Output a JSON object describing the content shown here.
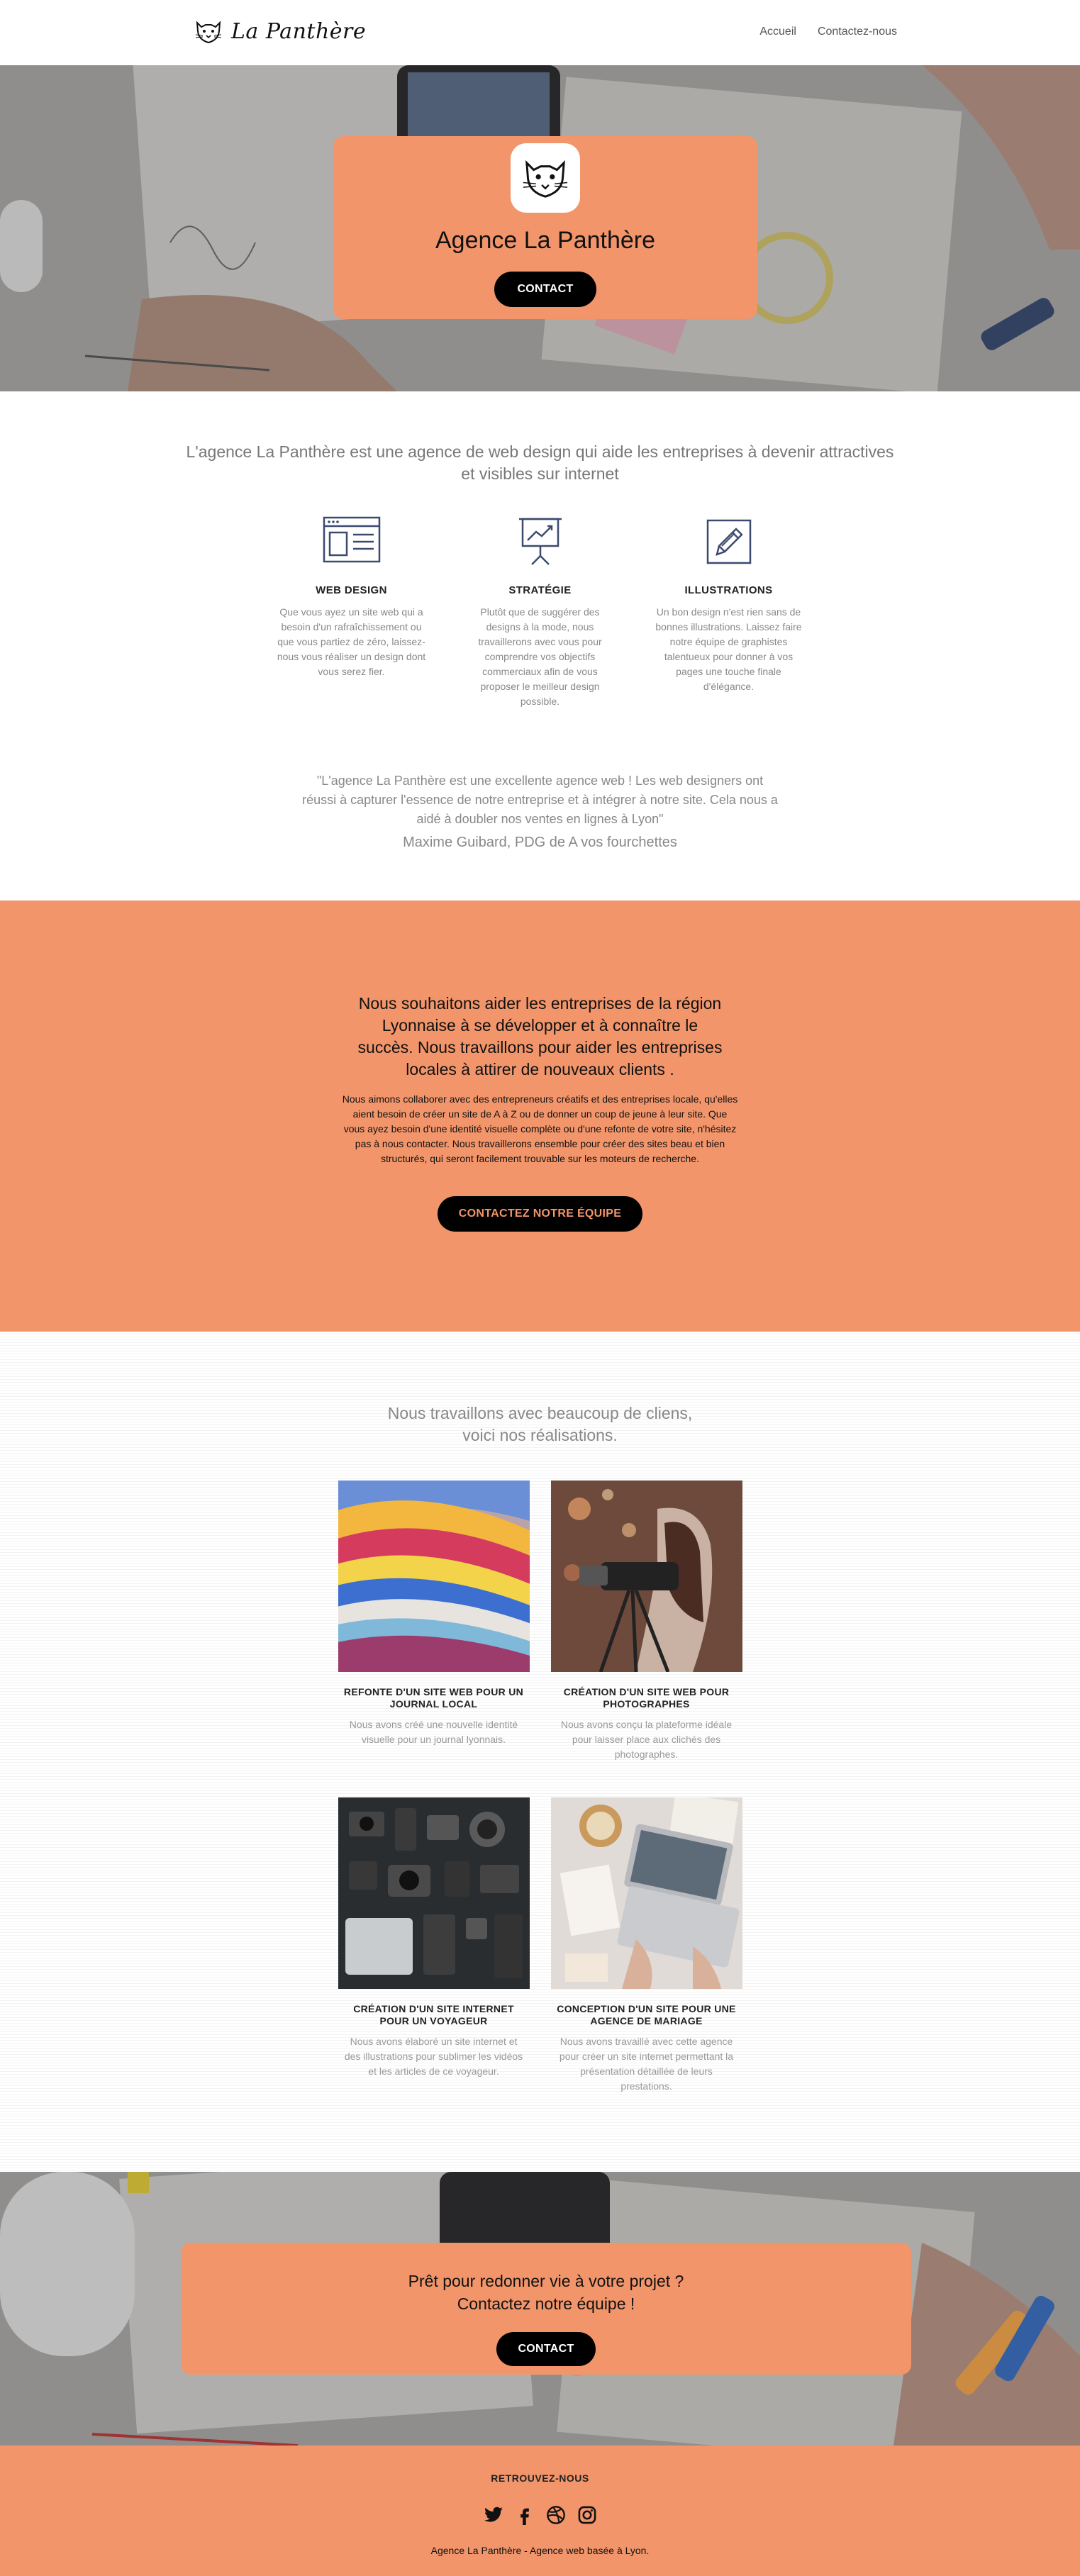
{
  "header": {
    "brand": "La Panthère",
    "nav": [
      "Accueil",
      "Contactez-nous"
    ]
  },
  "hero": {
    "title": "Agence La Panthère",
    "button": "CONTACT"
  },
  "intro": {
    "text": "L'agence La Panthère est une agence de web design qui aide les entreprises à devenir attractives et visibles sur internet",
    "services": [
      {
        "title": "WEB DESIGN",
        "icon": "browser-window-icon",
        "text": "Que vous ayez un site web qui a besoin d'un rafraîchissement ou que vous partiez de zéro, laissez-nous vous réaliser un design dont vous serez fier."
      },
      {
        "title": "STRATÉGIE",
        "icon": "presentation-chart-icon",
        "text": "Plutôt que de suggérer des designs à la mode, nous travaillerons avec vous pour comprendre vos objectifs commerciaux afin de vous proposer le meilleur design possible."
      },
      {
        "title": "ILLUSTRATIONS",
        "icon": "pencil-icon",
        "text": "Un bon design n'est rien sans de bonnes illustrations. Laissez faire notre équipe de graphistes talentueux pour donner à vos pages une touche finale d'élégance."
      }
    ],
    "quote": "\"L'agence La Panthère est une excellente agence web ! Les web designers ont réussi à capturer l'essence de notre entreprise et à intégrer à notre site. Cela nous a aidé à doubler nos ventes en lignes à Lyon\"",
    "quote_author": "Maxime Guibard, PDG de A vos fourchettes"
  },
  "mission": {
    "title": "Nous souhaitons aider les entreprises de la région Lyonnaise à se développer et à connaître le succès. Nous travaillons pour aider les entreprises locales à attirer de nouveaux clients .",
    "text": "Nous aimons collaborer avec des entrepreneurs créatifs et des entreprises locale, qu'elles aient besoin de créer un site de A à Z ou de donner un coup de jeune à leur site. Que vous ayez besoin d'une identité visuelle complète ou d'une refonte de votre site, n'hésitez pas à nous contacter. Nous travaillerons ensemble pour créer des sites beau et bien structurés, qui seront facilement trouvable sur les moteurs de recherche.",
    "button": "CONTACTEZ NOTRE ÉQUIPE"
  },
  "works": {
    "title_line1": "Nous travaillons avec beaucoup de cliens,",
    "title_line2": "voici nos réalisations.",
    "items": [
      {
        "title": "REFONTE D'UN SITE WEB POUR UN JOURNAL LOCAL",
        "text": "Nous avons créé une nouvelle identité visuelle pour un journal lyonnais."
      },
      {
        "title": "CRÉATION D'UN SITE WEB POUR PHOTOGRAPHES",
        "text": "Nous avons conçu la plateforme idéale pour laisser place aux clichés des photographes."
      },
      {
        "title": "CRÉATION D'UN SITE INTERNET POUR UN VOYAGEUR",
        "text": "Nous avons élaboré un site internet et des illustrations pour sublimer les vidéos et les articles de ce voyageur."
      },
      {
        "title": "CONCEPTION D'UN SITE POUR UNE AGENCE DE MARIAGE",
        "text": "Nous avons travaillé avec cette agence pour créer un site internet permettant la présentation détaillée de leurs prestations."
      }
    ]
  },
  "cta": {
    "line1": "Prêt pour redonner vie à votre projet ?",
    "line2": "Contactez notre équipe !",
    "button": "CONTACT"
  },
  "footer": {
    "heading": "RETROUVEZ-NOUS",
    "social": [
      "twitter-icon",
      "facebook-icon",
      "dribbble-icon",
      "instagram-icon"
    ],
    "copy": "Agence La Panthère - Agence web basée à Lyon."
  },
  "colors": {
    "accent": "#f2956a",
    "button": "#000000"
  }
}
